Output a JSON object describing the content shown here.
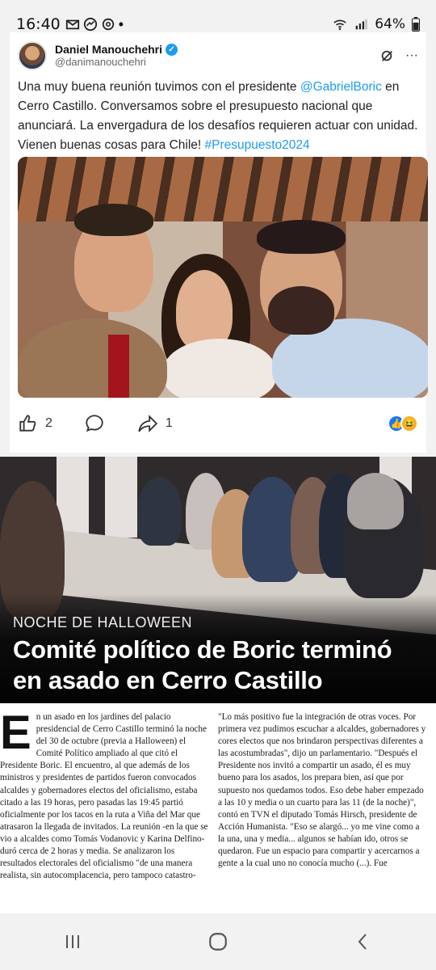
{
  "status_bar": {
    "time": "16:40",
    "battery": "64%",
    "icons_left": [
      "gmail-icon",
      "messenger-icon",
      "threads-icon",
      "dot"
    ],
    "icons_right": [
      "wifi-icon",
      "signal-icon",
      "battery-icon"
    ]
  },
  "tweet": {
    "display_name": "Daniel Manouchehri",
    "handle": "@danimanouchehri",
    "text_part1": "Una muy buena reunión tuvimos con el presidente ",
    "mention": "@GabrielBoric",
    "text_part2": " en Cerro Castillo. Conversamos sobre el presupuesto nacional que anunciará.  La envergadura de los desafíos requieren actuar con unidad. Vienen buenas cosas para Chile! ",
    "hashtag": "#Presupuesto2024",
    "likes": "2",
    "shares": "1"
  },
  "article": {
    "kicker": "NOCHE DE HALLOWEEN",
    "headline": "Comité político de Boric terminó en asado en Cerro Castillo",
    "dropcap": "E",
    "col1": "n un asado en los jardines del palacio presidencial de Cerro Castillo terminó la noche del 30 de octubre (previa a Halloween) el Comité Político ampliado al que citó el Presidente Boric. El encuentro, al que además de los ministros y presidentes de partidos fueron convocados alcaldes y gobernadores electos del oficialismo, estaba citado a las 19 horas, pero pasadas las 19:45 partió oficialmente por los tacos en la ruta a Viña del Mar que atrasaron la llegada de invitados. La reunión -en la que se vio a alcaldes como Tomás Vodanovic y Karina Delfino- duró cerca de 2 horas y media. Se analizaron los resultados electorales del oficialismo \"de una manera realista, sin autocomplacencia, pero tampoco catastro-",
    "col2": "\"Lo más positivo fue la integración de otras voces. Por primera vez pudimos escuchar a alcaldes, gobernadores y cores electos que nos brindaron perspectivas diferentes a las acostumbradas\", dijo un parlamentario. \"Después el Presidente nos invitó a compartir un asado, él es muy bueno para los asados, los prepara bien, así que por supuesto nos quedamos todos. Eso debe haber empezado a las 10 y media o un cuarto para las 11 (de la noche)\", contó en TVN el diputado Tomás Hirsch, presidente de Acción Humanista. \"Eso se alargó... yo me vine como a la una, una y media... algunos se habían ido, otros se quedaron. Fue un espacio para compartir y acercarnos a gente a la cual uno no conocía mucho (...). Fue"
  },
  "colors": {
    "link": "#1d9bf0",
    "verified": "#1d9bf0",
    "like_reaction": "#1877f2",
    "haha_reaction": "#f7b125"
  }
}
